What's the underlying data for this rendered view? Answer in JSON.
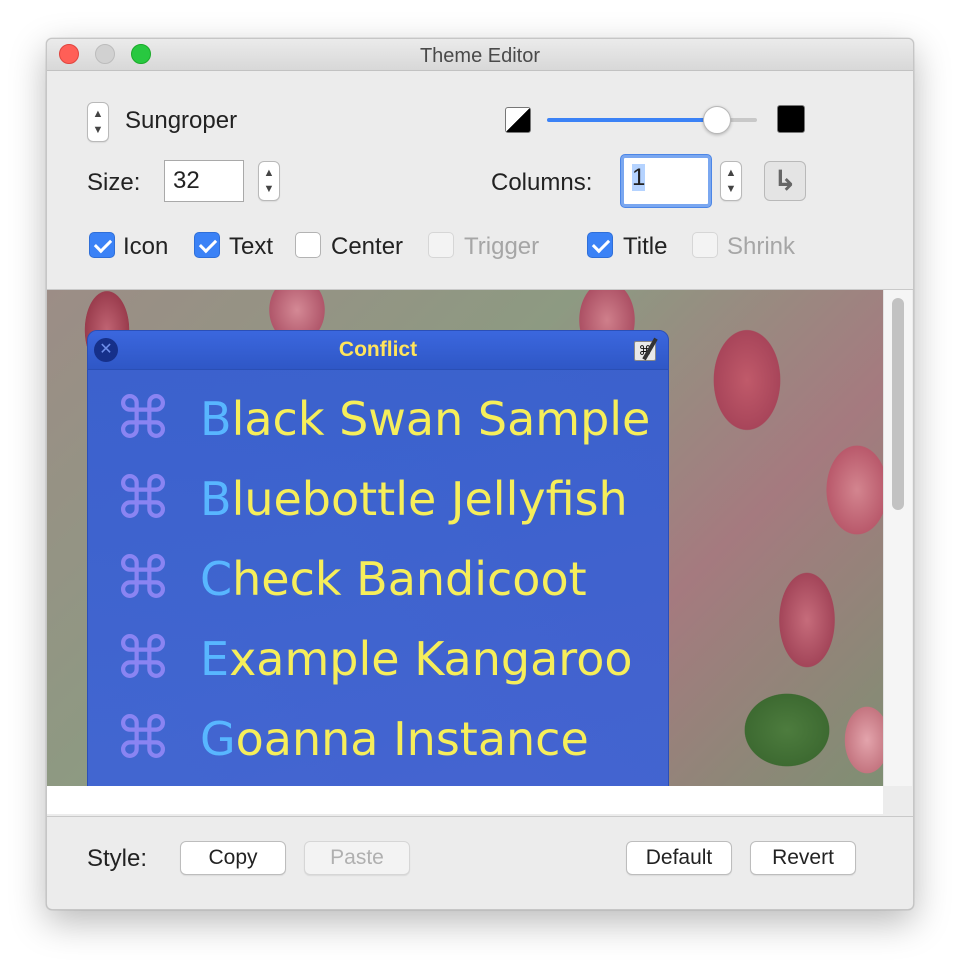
{
  "window": {
    "title": "Theme Editor"
  },
  "theme": {
    "name": "Sungroper"
  },
  "size": {
    "label": "Size:",
    "value": "32"
  },
  "columns": {
    "label": "Columns:",
    "value": "1"
  },
  "options": [
    {
      "label": "Icon",
      "checked": true,
      "enabled": true
    },
    {
      "label": "Text",
      "checked": true,
      "enabled": true
    },
    {
      "label": "Center",
      "checked": false,
      "enabled": true
    },
    {
      "label": "Trigger",
      "checked": false,
      "enabled": false
    },
    {
      "label": "Title",
      "checked": true,
      "enabled": true
    },
    {
      "label": "Shrink",
      "checked": false,
      "enabled": false
    }
  ],
  "opacity_slider": {
    "value": 0.9
  },
  "preview": {
    "panel_title": "Conflict",
    "rows": [
      {
        "icon": "⌘",
        "first": "B",
        "rest": "lack Swan Sample"
      },
      {
        "icon": "⌘",
        "first": "B",
        "rest": "luebottle Jellyfish"
      },
      {
        "icon": "⌘",
        "first": "C",
        "rest": "heck Bandicoot"
      },
      {
        "icon": "⌘",
        "first": "E",
        "rest": "xample Kangaroo"
      },
      {
        "icon": "⌘",
        "first": "G",
        "rest": "oanna Instance"
      }
    ]
  },
  "footer": {
    "style_label": "Style:",
    "copy": "Copy",
    "paste": "Paste",
    "default": "Default",
    "revert": "Revert"
  },
  "colors": {
    "accent": "#3b82f6",
    "panel_bg": "#3a63d6",
    "text_yellow": "#f6ee5a",
    "text_first_letter": "#58b6ff",
    "icon_purple": "#8a84f2",
    "panel_title": "#ffe45c"
  }
}
